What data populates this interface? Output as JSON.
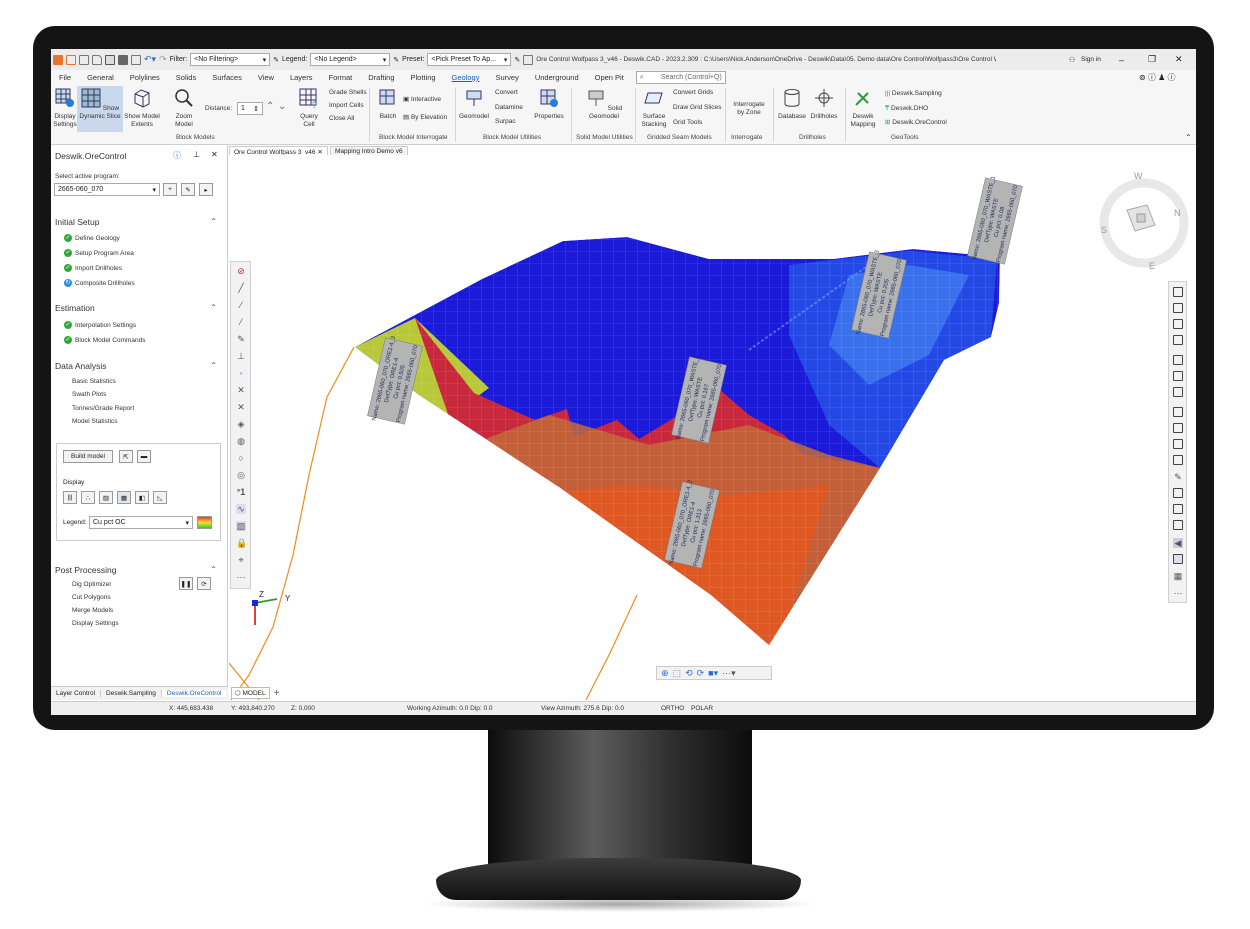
{
  "titlebar": {
    "filter_label": "Filter:",
    "filter_value": "<No Filtering>",
    "legend_label": "Legend:",
    "legend_value": "<No Legend>",
    "preset_label": "Preset:",
    "preset_value": "<Pick Preset To Ap...",
    "title": "Ore Control Wolfpass 3_v46 - Deswik.CAD - 2023.2.309 : C:\\Users\\Nick.Anderson\\OneDrive - Deswik\\Data\\05. Demo data\\Ore Control\\Wolfpass3\\Ore Control Wolfpas...",
    "sign_in": "Sign in",
    "min": "–",
    "max": "❐",
    "close": "✕"
  },
  "menu": [
    "File",
    "General",
    "Polylines",
    "Solids",
    "Surfaces",
    "View",
    "Layers",
    "Format",
    "Drafting",
    "Plotting",
    "Geology",
    "Survey",
    "Underground",
    "Open Pit"
  ],
  "menu_active": "Geology",
  "search_placeholder": "Search (Control+Q)",
  "ribbon": {
    "display_settings": "Display Settings",
    "show_dynamic_slice": "Show Dynamic Slice",
    "show_model_extents": "Show Model Extents",
    "zoom_model": "Zoom Model",
    "distance_label": "Distance:",
    "distance_value": "1",
    "query_cell": "Query Cell",
    "grade_shells": "Grade Shells",
    "import_cells": "Import Cells",
    "close_all": "Close All",
    "block_models": "Block Models",
    "interactive": "Interactive",
    "batch": "Batch",
    "by_elevation": "By Elevation",
    "bm_interrogate": "Block Model Interrogate",
    "geomodel": "Geomodel",
    "convert": "Convert",
    "datamine": "Datamine",
    "surpac": "Surpac",
    "properties": "Properties",
    "bm_utilities": "Block Model Utilities",
    "solid_geomodel": "Solid Geomodel",
    "sm_utilities": "Solid Model Utilities",
    "convert_grids": "Convert Grids",
    "draw_grid_slices": "Draw Grid Slices",
    "surface_stacking": "Surface Stacking",
    "grid_tools": "Grid Tools",
    "gridded_seam": "Gridded Seam Models",
    "interrogate_by_zone": "Interrogate by Zone",
    "interrogate": "Interrogate",
    "database": "Database",
    "drillholes_btn": "Drillholes",
    "drillholes": "Drillholes",
    "deswik_mapping": "Deswik Mapping",
    "deswik_sampling": "Deswik.Sampling",
    "deswik_dho": "Deswik.DHO",
    "deswik_orecontrol": "Deswik.OreControl",
    "geotools": "GeoTools"
  },
  "panel": {
    "title": "Deswik.OreControl",
    "select_label": "Select active program:",
    "program": "2665-060_070",
    "initial_setup": "Initial Setup",
    "setup_items": [
      "Define Geology",
      "Setup Program Area",
      "Import Drillholes",
      "Composite Drillholes"
    ],
    "estimation": "Estimation",
    "estimation_items": [
      "Interpolation Settings",
      "Block Model Commands"
    ],
    "data_analysis": "Data Analysis",
    "analysis_items": [
      "Basic Statistics",
      "Swath Plots",
      "Tonnes/Grade Report",
      "Model Statistics"
    ],
    "build_model": "Build model",
    "display": "Display",
    "legend_label": "Legend:",
    "legend_value": "Cu pct OC",
    "post_processing": "Post Processing",
    "post_items": [
      "Dig Optimizer",
      "Cut Polygons",
      "Merge Models",
      "Display Settings"
    ]
  },
  "doc_tabs": [
    "Ore Control Wolfpass 3_v46",
    "Mapping Intro Demo v6"
  ],
  "bottom_tabs": [
    "Layer Control",
    "Deswik.Sampling",
    "Deswik.OreControl"
  ],
  "bottom_tab_active": "Deswik.OreControl",
  "model_tab": "MODEL",
  "axis": {
    "z": "Z",
    "y": "Y",
    "x": "X"
  },
  "compass": {
    "n": "N",
    "e": "E",
    "s": "S",
    "w": "W"
  },
  "labels": [
    {
      "lines": [
        "Name: 2665-060_070_ORE1-4_3",
        "DefType: ORE1-4",
        "Cu pct: 0.505",
        "Program name: 2665-060_070"
      ]
    },
    {
      "lines": [
        "Name: 2665-060_070_WASTE_4",
        "DefType: WASTE",
        "Cu pct: 0.167",
        "Program name: 2665-060_070"
      ]
    },
    {
      "lines": [
        "Name: 2665-060_070_ORE1-4_2",
        "DefType: ORE1-4",
        "Cu pct: 1.313",
        "Program name: 2665-060_070"
      ]
    },
    {
      "lines": [
        "Name: 2665-060_070_WASTE_3",
        "DefType: WASTE",
        "Cu pct: 0.205",
        "Program name: 2665-060_070"
      ]
    },
    {
      "lines": [
        "Name: 2665-060_070_WASTE_1",
        "DefType: WASTE",
        "Cu pct: 0.08",
        "Program name: 2665-060_070"
      ]
    }
  ],
  "status": {
    "x": "X: 445,683.438",
    "y": "Y: 493,840.270",
    "z": "Z: 0.000",
    "working_azimuth": "Working Azimuth: 0.0 Dip: 0.0",
    "view_azimuth": "View Azimuth: 275.6 Dip: 0.0",
    "ortho": "ORTHO",
    "polar": "POLAR"
  },
  "colors": {
    "waste": "#1a1ad8",
    "ore_red": "#c8283c",
    "ore_orange": "#e2571e",
    "low_grade": "#b8c83a",
    "contour": "#f08a1a",
    "accent": "#1a5fb4"
  }
}
